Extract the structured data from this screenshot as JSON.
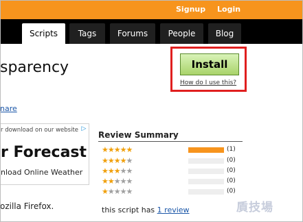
{
  "header": {
    "signup": "Signup",
    "login": "Login"
  },
  "nav": {
    "tabs": [
      "Scripts",
      "Tags",
      "Forums",
      "People",
      "Blog"
    ],
    "active": "Scripts"
  },
  "script": {
    "title_partial": "sparency",
    "share_partial": "nare"
  },
  "install": {
    "button": "Install",
    "howto": "How do I use this?"
  },
  "ad": {
    "top_text": "r download on our website",
    "title": "r Forecast",
    "sub": "nload Online Weather",
    "badge": "▷"
  },
  "below_ad_text": "ozilla Firefox.",
  "reviews": {
    "title": "Review Summary",
    "rows": [
      {
        "stars": 5,
        "fill": 1.0,
        "count": "(1)"
      },
      {
        "stars": 4,
        "fill": 0.0,
        "count": "(0)"
      },
      {
        "stars": 3,
        "fill": 0.0,
        "count": "(0)"
      },
      {
        "stars": 2,
        "fill": 0.0,
        "count": "(0)"
      },
      {
        "stars": 1,
        "fill": 0.0,
        "count": "(0)"
      }
    ],
    "summary_prefix": "this script has ",
    "summary_link": "1 review"
  },
  "watermark": "貭技場",
  "colors": {
    "orange": "#f7941d",
    "install_border": "#e01f1f",
    "link": "#1a56a8"
  }
}
